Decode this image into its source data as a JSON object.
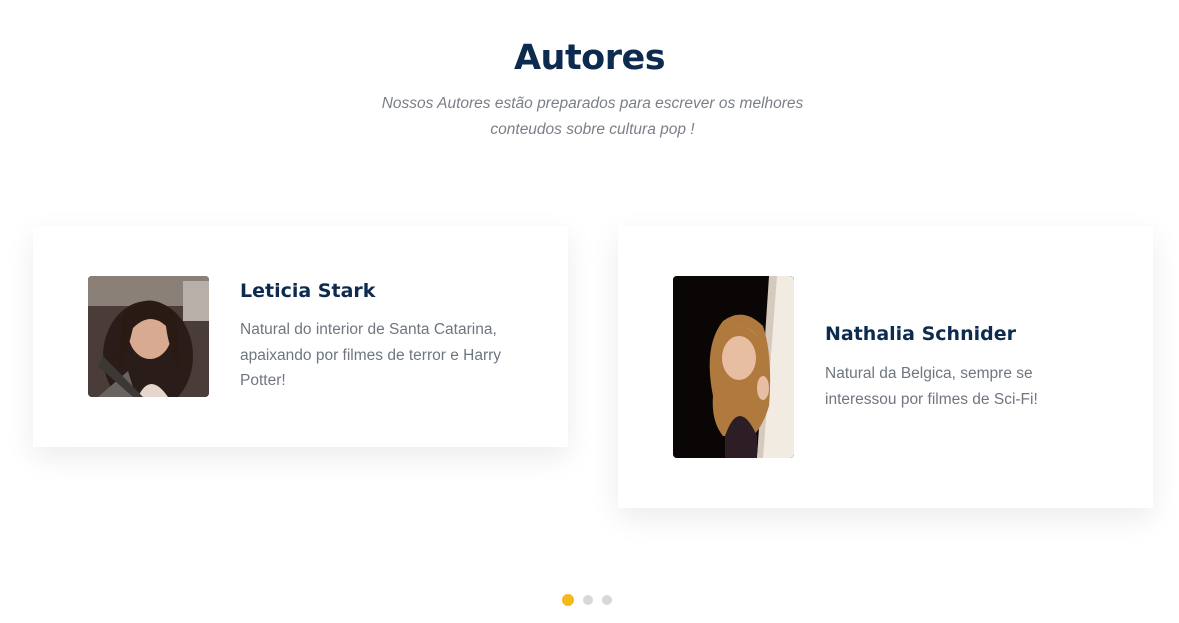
{
  "section": {
    "title": "Autores",
    "subtitle": "Nossos Autores estão preparados para escrever os melhores conteudos sobre cultura pop !"
  },
  "authors": [
    {
      "name": "Leticia Stark",
      "bio": "Natural do interior de Santa Catarina, apaixando por filmes de terror e Harry Potter!"
    },
    {
      "name": "Nathalia Schnider",
      "bio": "Natural da Belgica, sempre se interessou por filmes de Sci-Fi!"
    }
  ],
  "carousel": {
    "page_count": 3,
    "active_index": 0,
    "active_color": "#f5b91e",
    "inactive_color": "#d8d8d8"
  },
  "colors": {
    "heading": "#0d2a4f",
    "body_text": "#6f7680"
  }
}
